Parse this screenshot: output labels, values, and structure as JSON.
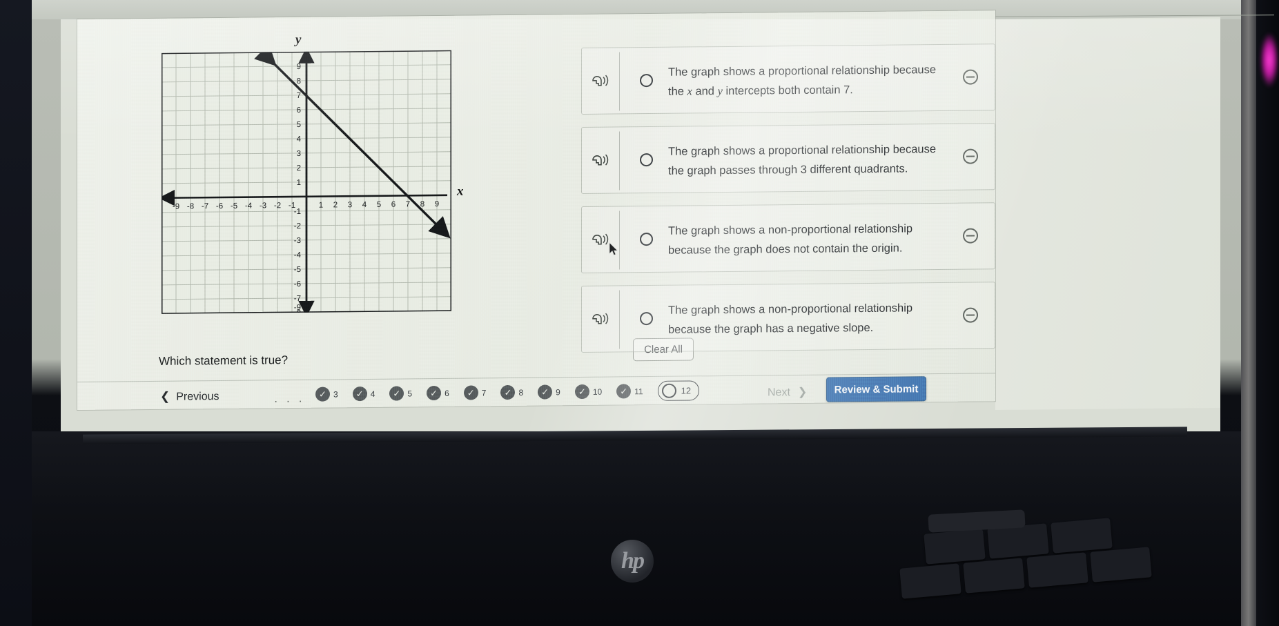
{
  "header": {
    "flag_icon": "flag-icon"
  },
  "graph": {
    "y_axis_label": "y",
    "x_axis_label": "x",
    "x_ticks": [
      "-9",
      "-8",
      "-7",
      "-6",
      "-5",
      "-4",
      "-3",
      "-2",
      "-1",
      "1",
      "2",
      "3",
      "4",
      "5",
      "6",
      "7",
      "8",
      "9"
    ],
    "y_ticks": [
      "9",
      "8",
      "7",
      "6",
      "5",
      "4",
      "3",
      "2",
      "1",
      "-1",
      "-2",
      "-3",
      "-4",
      "-5",
      "-6",
      "-7",
      "-8",
      "-9"
    ]
  },
  "chart_data": {
    "type": "line",
    "title": "",
    "xlabel": "x",
    "ylabel": "y",
    "xlim": [
      -9.5,
      9.5
    ],
    "ylim": [
      -9.5,
      9.5
    ],
    "grid": true,
    "legend": "none",
    "series": [
      {
        "name": "line",
        "equation": "y = -x + 7",
        "slope": -1,
        "y_intercept": 7,
        "x_intercept": 7,
        "arrow_both_ends": true,
        "points": [
          [
            -2.5,
            9.5
          ],
          [
            0,
            7
          ],
          [
            7,
            0
          ],
          [
            9.5,
            -2.5
          ]
        ]
      }
    ],
    "x_tick_labels": [
      "-9",
      "-8",
      "-7",
      "-6",
      "-5",
      "-4",
      "-3",
      "-2",
      "-1",
      "1",
      "2",
      "3",
      "4",
      "5",
      "6",
      "7",
      "8",
      "9"
    ],
    "y_tick_labels": [
      "9",
      "8",
      "7",
      "6",
      "5",
      "4",
      "3",
      "2",
      "1",
      "-1",
      "-2",
      "-3",
      "-4",
      "-5",
      "-6",
      "-7",
      "-8",
      "-9"
    ]
  },
  "question": {
    "prompt": "Which statement is true?",
    "clear_label": "Clear All",
    "options": [
      {
        "id": "a",
        "text_part1": "The graph shows a proportional relationship because the ",
        "italic1": "x",
        "text_part2": " and ",
        "italic2": "y",
        "text_part3": " intercepts both contain 7.",
        "selected": false,
        "eliminated": false
      },
      {
        "id": "b",
        "text_part1": "The graph shows a proportional relationship because the graph passes through 3 different quadrants.",
        "italic1": "",
        "text_part2": "",
        "italic2": "",
        "text_part3": "",
        "selected": false,
        "eliminated": false
      },
      {
        "id": "c",
        "text_part1": "The graph shows a non-proportional relationship because the graph does not contain the origin.",
        "italic1": "",
        "text_part2": "",
        "italic2": "",
        "text_part3": "",
        "selected": false,
        "eliminated": false
      },
      {
        "id": "d",
        "text_part1": "The graph shows a non-proportional relationship because the graph has a negative slope.",
        "italic1": "",
        "text_part2": "",
        "italic2": "",
        "text_part3": "",
        "selected": false,
        "eliminated": false
      }
    ]
  },
  "nav": {
    "previous_label": "Previous",
    "previous_chevron": "❮",
    "ellipsis": "· · ·",
    "next_label": "Next",
    "next_chevron": "❯",
    "review_label": "Review & Submit",
    "pages": [
      {
        "num": "3",
        "state": "answered"
      },
      {
        "num": "4",
        "state": "answered"
      },
      {
        "num": "5",
        "state": "answered"
      },
      {
        "num": "6",
        "state": "answered"
      },
      {
        "num": "7",
        "state": "answered"
      },
      {
        "num": "8",
        "state": "answered"
      },
      {
        "num": "9",
        "state": "answered"
      },
      {
        "num": "10",
        "state": "answered"
      },
      {
        "num": "11",
        "state": "answered"
      },
      {
        "num": "12",
        "state": "current"
      }
    ],
    "check_glyph": "✓"
  },
  "device": {
    "brand": "hp"
  },
  "colors": {
    "accent_button": "#3d6fad",
    "page_bg": "#e9ece4",
    "tick_badge": "#55595b",
    "text": "#1b1e21",
    "muted_text": "#9aa09b"
  }
}
